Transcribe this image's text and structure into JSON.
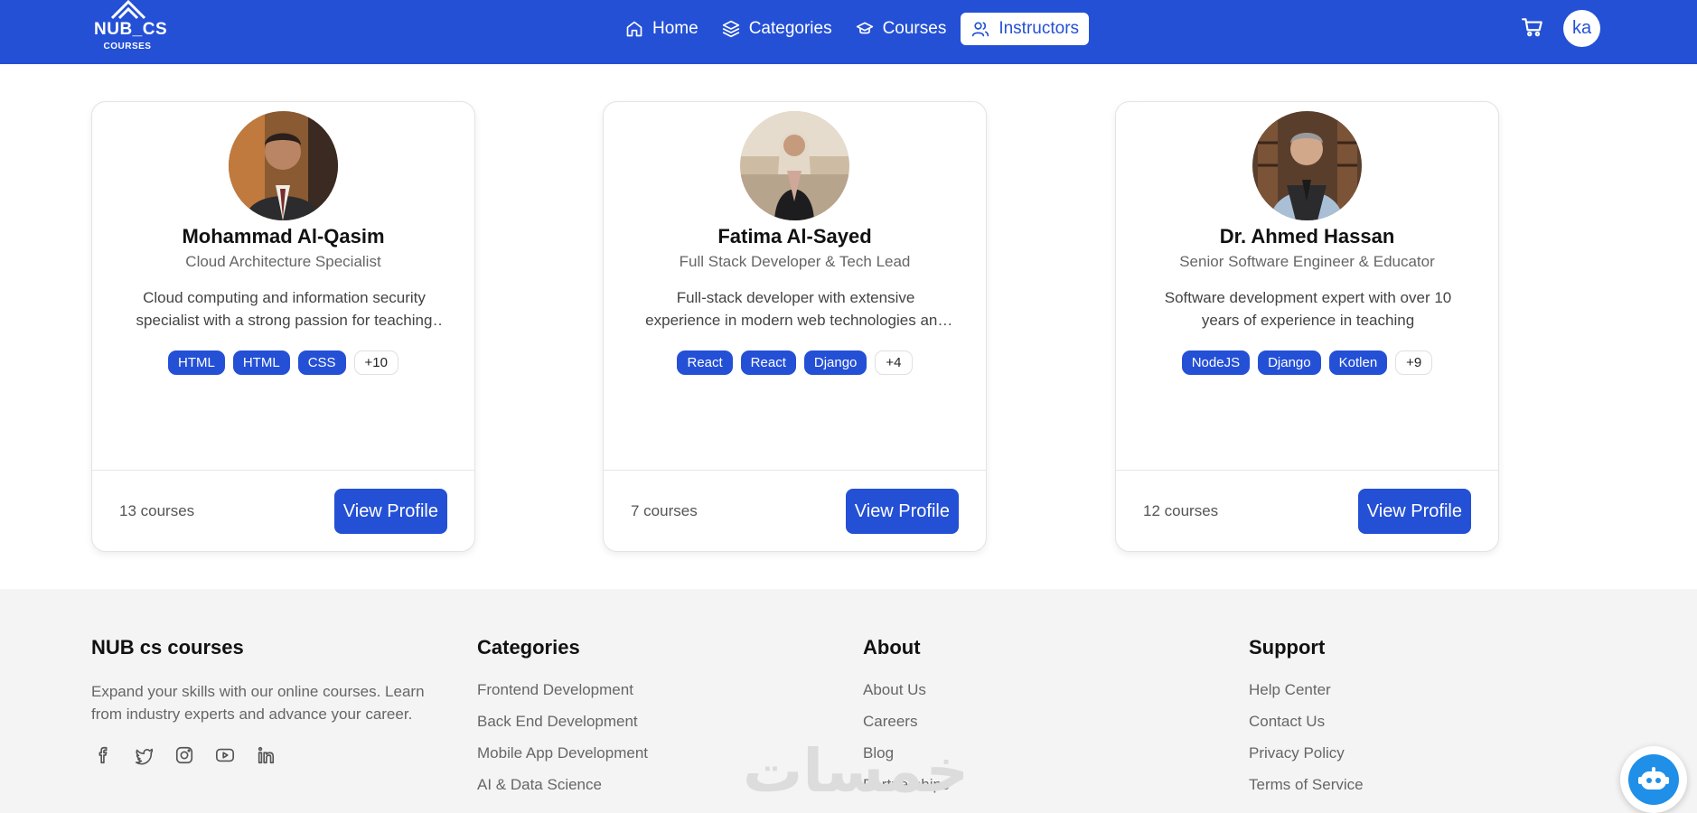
{
  "brand": {
    "title": "NUB_CS",
    "subtitle": "COURSES"
  },
  "nav": {
    "items": [
      {
        "label": "Home",
        "icon": "home-icon"
      },
      {
        "label": "Categories",
        "icon": "layers-icon"
      },
      {
        "label": "Courses",
        "icon": "graduation-cap-icon"
      },
      {
        "label": "Instructors",
        "icon": "users-icon",
        "active": true
      }
    ],
    "avatar_initials": "ka"
  },
  "instructors": [
    {
      "name": "Mohammad Al-Qasim",
      "role": "Cloud Architecture Specialist",
      "description": "Cloud computing and information security specialist with a strong passion for teaching and mentoring",
      "tags": [
        "HTML",
        "HTML",
        "CSS"
      ],
      "more": "+10",
      "courses": "13 courses",
      "button": "View Profile"
    },
    {
      "name": "Fatima Al-Sayed",
      "role": "Full Stack Developer & Tech Lead",
      "description": "Full-stack developer with extensive experience in modern web technologies and technical leadership",
      "tags": [
        "React",
        "React",
        "Django"
      ],
      "more": "+4",
      "courses": "7 courses",
      "button": "View Profile"
    },
    {
      "name": "Dr. Ahmed Hassan",
      "role": "Senior Software Engineer & Educator",
      "description": "Software development expert with over 10 years of experience in teaching",
      "tags": [
        "NodeJS",
        "Django",
        "Kotlen"
      ],
      "more": "+9",
      "courses": "12 courses",
      "button": "View Profile"
    }
  ],
  "footer": {
    "about_col": {
      "title": "NUB cs courses",
      "text": "Expand your skills with our online courses. Learn from industry experts and advance your career."
    },
    "categories": {
      "title": "Categories",
      "links": [
        "Frontend Development",
        "Back End Development",
        "Mobile App Development",
        "AI & Data Science"
      ]
    },
    "about": {
      "title": "About",
      "links": [
        "About Us",
        "Careers",
        "Blog",
        "Partnerships"
      ]
    },
    "support": {
      "title": "Support",
      "links": [
        "Help Center",
        "Contact Us",
        "Privacy Policy",
        "Terms of Service"
      ]
    },
    "social_icons": [
      "facebook-icon",
      "twitter-icon",
      "instagram-icon",
      "youtube-icon",
      "linkedin-icon"
    ]
  },
  "watermark": "خمسات",
  "colors": {
    "primary": "#2450d6",
    "footer_bg": "#f4f4f4",
    "chatbot": "#1f8fe8"
  }
}
